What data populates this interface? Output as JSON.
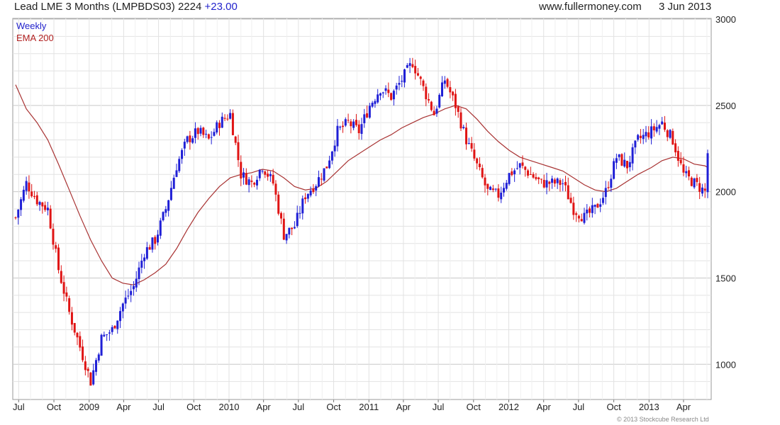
{
  "header": {
    "instrument": "Lead LME 3 Months (LMPBDS03)",
    "last_price": "2224",
    "change": "+23.00",
    "site": "www.fullermoney.com",
    "date": "3 Jun 2013"
  },
  "legend": {
    "series1": "Weekly",
    "series2": "EMA 200"
  },
  "copyright": "© 2013 Stockcube Research Ltd",
  "colors": {
    "up": "#1f1fd6",
    "down": "#e01414",
    "ema": "#a83232",
    "grid": "#e2e2e2",
    "grid_major": "#c8c8c8"
  },
  "chart_data": {
    "type": "line",
    "subtype": "candlestick-with-moving-average",
    "x_ticks": [
      "Jul",
      "Oct",
      "2009",
      "Apr",
      "Jul",
      "Oct",
      "2010",
      "Apr",
      "Jul",
      "Oct",
      "2011",
      "Apr",
      "Jul",
      "Oct",
      "2012",
      "Apr",
      "Jul",
      "Oct",
      "2013",
      "Apr"
    ],
    "y_ticks": [
      1000,
      1500,
      2000,
      2500,
      3000
    ],
    "ylim": [
      800,
      3000
    ],
    "x_range": [
      "2008-06-23",
      "2013-06-03"
    ],
    "y_axis_position": "right",
    "legend_position": "top-left",
    "grid": true,
    "series": [
      {
        "name": "Weekly",
        "kind": "close",
        "x": [
          "2008-06-23",
          "2008-07-21",
          "2008-08-18",
          "2008-09-15",
          "2008-10-13",
          "2008-11-10",
          "2008-12-08",
          "2009-01-05",
          "2009-02-02",
          "2009-03-02",
          "2009-03-30",
          "2009-04-27",
          "2009-05-25",
          "2009-06-22",
          "2009-07-20",
          "2009-08-17",
          "2009-09-14",
          "2009-10-12",
          "2009-11-09",
          "2009-12-07",
          "2010-01-04",
          "2010-02-01",
          "2010-03-01",
          "2010-03-29",
          "2010-04-26",
          "2010-05-24",
          "2010-06-21",
          "2010-07-19",
          "2010-08-16",
          "2010-09-13",
          "2010-10-11",
          "2010-11-08",
          "2010-12-06",
          "2011-01-03",
          "2011-01-31",
          "2011-02-28",
          "2011-03-28",
          "2011-04-25",
          "2011-05-23",
          "2011-06-20",
          "2011-07-18",
          "2011-08-15",
          "2011-09-12",
          "2011-10-10",
          "2011-11-07",
          "2011-12-05",
          "2012-01-02",
          "2012-01-30",
          "2012-02-27",
          "2012-03-26",
          "2012-04-23",
          "2012-05-21",
          "2012-06-18",
          "2012-07-16",
          "2012-08-13",
          "2012-09-10",
          "2012-10-08",
          "2012-11-05",
          "2012-12-03",
          "2013-01-07",
          "2013-02-04",
          "2013-03-04",
          "2013-04-01",
          "2013-04-29",
          "2013-05-27",
          "2013-06-03"
        ],
        "y": [
          1850,
          2050,
          1950,
          1900,
          1550,
          1300,
          1100,
          900,
          1150,
          1200,
          1350,
          1450,
          1650,
          1720,
          1900,
          2150,
          2300,
          2350,
          2300,
          2400,
          2450,
          2100,
          2050,
          2150,
          2050,
          1750,
          1800,
          1980,
          2050,
          2150,
          2350,
          2400,
          2350,
          2500,
          2600,
          2550,
          2650,
          2750,
          2600,
          2450,
          2650,
          2500,
          2300,
          2150,
          2000,
          1980,
          2100,
          2150,
          2100,
          2050,
          2050,
          2050,
          1900,
          1850,
          1900,
          2000,
          2200,
          2150,
          2300,
          2350,
          2400,
          2300,
          2100,
          2050,
          2000,
          2224
        ]
      },
      {
        "name": "EMA 200",
        "kind": "line",
        "x": [
          "2008-06-23",
          "2008-07-21",
          "2008-08-18",
          "2008-09-15",
          "2008-10-13",
          "2008-11-10",
          "2008-12-08",
          "2009-01-05",
          "2009-02-02",
          "2009-03-02",
          "2009-03-30",
          "2009-04-27",
          "2009-05-25",
          "2009-06-22",
          "2009-07-20",
          "2009-08-17",
          "2009-09-14",
          "2009-10-12",
          "2009-11-09",
          "2009-12-07",
          "2010-01-04",
          "2010-02-01",
          "2010-03-01",
          "2010-03-29",
          "2010-04-26",
          "2010-05-24",
          "2010-06-21",
          "2010-07-19",
          "2010-08-16",
          "2010-09-13",
          "2010-10-11",
          "2010-11-08",
          "2010-12-06",
          "2011-01-03",
          "2011-01-31",
          "2011-02-28",
          "2011-03-28",
          "2011-04-25",
          "2011-05-23",
          "2011-06-20",
          "2011-07-18",
          "2011-08-15",
          "2011-09-12",
          "2011-10-10",
          "2011-11-07",
          "2011-12-05",
          "2012-01-02",
          "2012-01-30",
          "2012-02-27",
          "2012-03-26",
          "2012-04-23",
          "2012-05-21",
          "2012-06-18",
          "2012-07-16",
          "2012-08-13",
          "2012-09-10",
          "2012-10-08",
          "2012-11-05",
          "2012-12-03",
          "2013-01-07",
          "2013-02-04",
          "2013-03-04",
          "2013-04-01",
          "2013-04-29",
          "2013-05-27",
          "2013-06-03"
        ],
        "y": [
          2620,
          2480,
          2400,
          2300,
          2160,
          2010,
          1860,
          1720,
          1600,
          1500,
          1470,
          1460,
          1490,
          1530,
          1580,
          1670,
          1780,
          1880,
          1960,
          2030,
          2080,
          2100,
          2110,
          2130,
          2120,
          2080,
          2030,
          2010,
          2020,
          2060,
          2120,
          2180,
          2220,
          2260,
          2300,
          2330,
          2370,
          2400,
          2430,
          2450,
          2480,
          2500,
          2480,
          2420,
          2350,
          2290,
          2240,
          2200,
          2180,
          2160,
          2140,
          2120,
          2080,
          2040,
          2010,
          2000,
          2020,
          2060,
          2100,
          2140,
          2180,
          2200,
          2190,
          2160,
          2150,
          2140
        ]
      }
    ]
  }
}
